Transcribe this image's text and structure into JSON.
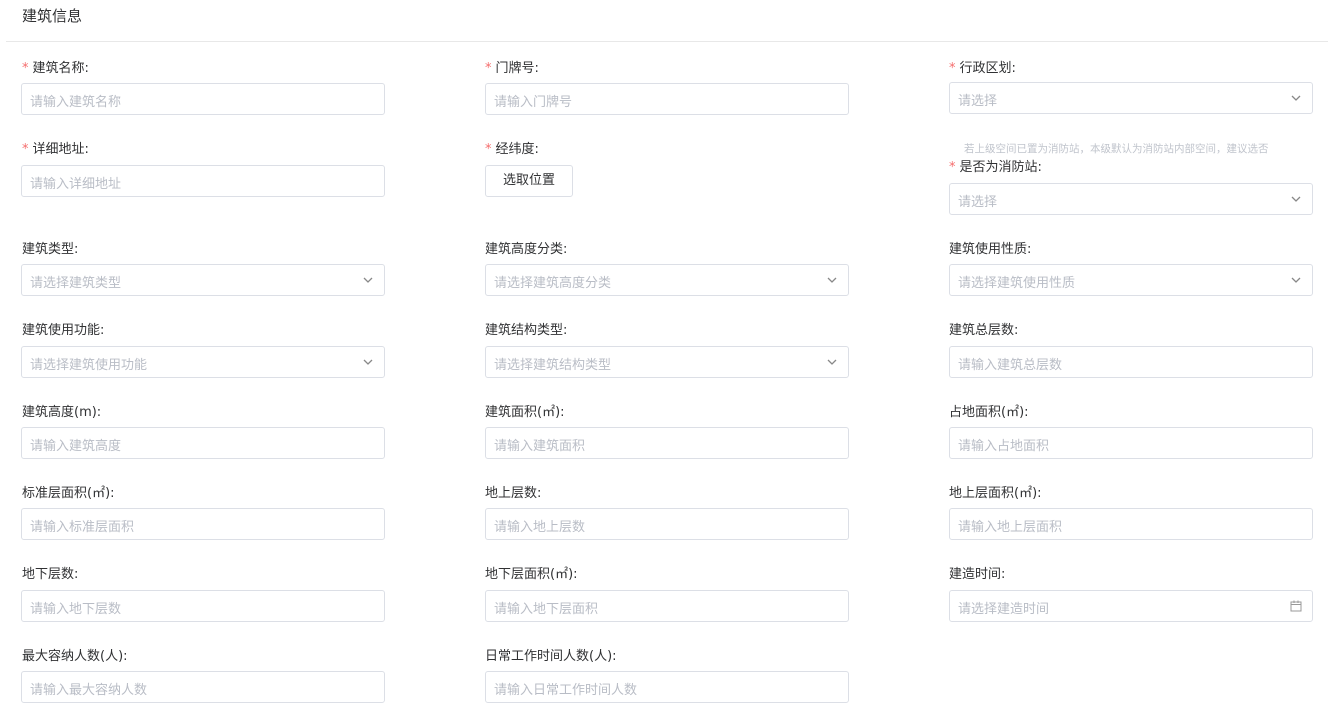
{
  "section_title": "建筑信息",
  "hint_text": "若上级空间已置为消防站，本级默认为消防站内部空间，建议选否",
  "fields": {
    "building_name": {
      "label": "建筑名称:",
      "placeholder": "请输入建筑名称",
      "required": true
    },
    "door_number": {
      "label": "门牌号:",
      "placeholder": "请输入门牌号",
      "required": true
    },
    "admin_region": {
      "label": "行政区划:",
      "placeholder": "请选择",
      "required": true
    },
    "address": {
      "label": "详细地址:",
      "placeholder": "请输入详细地址",
      "required": true
    },
    "lnglat": {
      "label": "经纬度:",
      "button": "选取位置",
      "required": true
    },
    "is_fire_station": {
      "label": "是否为消防站:",
      "placeholder": "请选择",
      "required": true
    },
    "building_type": {
      "label": "建筑类型:",
      "placeholder": "请选择建筑类型"
    },
    "height_class": {
      "label": "建筑高度分类:",
      "placeholder": "请选择建筑高度分类"
    },
    "use_nature": {
      "label": "建筑使用性质:",
      "placeholder": "请选择建筑使用性质"
    },
    "use_function": {
      "label": "建筑使用功能:",
      "placeholder": "请选择建筑使用功能"
    },
    "structure_type": {
      "label": "建筑结构类型:",
      "placeholder": "请选择建筑结构类型"
    },
    "total_floors": {
      "label": "建筑总层数:",
      "placeholder": "请输入建筑总层数"
    },
    "height": {
      "label": "建筑高度(m):",
      "placeholder": "请输入建筑高度"
    },
    "building_area": {
      "label": "建筑面积(㎡):",
      "placeholder": "请输入建筑面积"
    },
    "land_area": {
      "label": "占地面积(㎡):",
      "placeholder": "请输入占地面积"
    },
    "standard_floor_area": {
      "label": "标准层面积(㎡):",
      "placeholder": "请输入标准层面积"
    },
    "above_floors": {
      "label": "地上层数:",
      "placeholder": "请输入地上层数"
    },
    "above_floor_area": {
      "label": "地上层面积(㎡):",
      "placeholder": "请输入地上层面积"
    },
    "under_floors": {
      "label": "地下层数:",
      "placeholder": "请输入地下层数"
    },
    "under_floor_area": {
      "label": "地下层面积(㎡):",
      "placeholder": "请输入地下层面积"
    },
    "build_time": {
      "label": "建造时间:",
      "placeholder": "请选择建造时间"
    },
    "max_capacity": {
      "label": "最大容纳人数(人):",
      "placeholder": "请输入最大容纳人数"
    },
    "daily_workers": {
      "label": "日常工作时间人数(人):",
      "placeholder": "请输入日常工作时间人数"
    }
  }
}
